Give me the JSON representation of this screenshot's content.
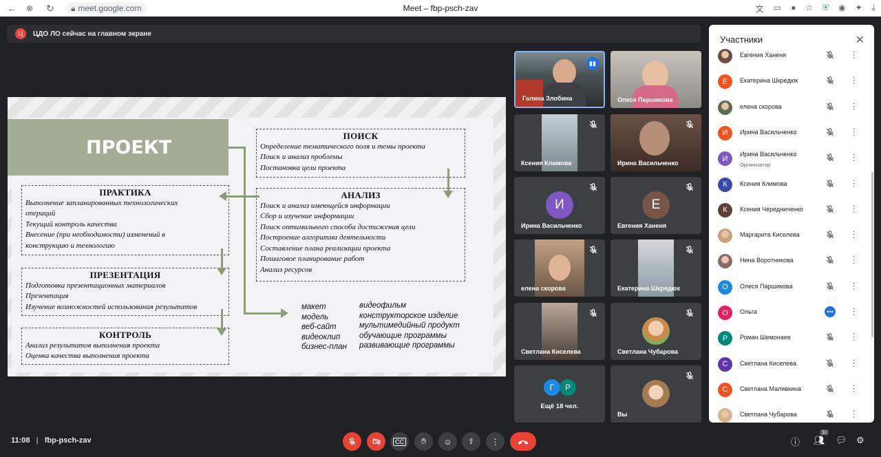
{
  "browser": {
    "url": "meet.google.com",
    "title": "Meet – fbp-psch-zav"
  },
  "banner": {
    "avatar": "Ц",
    "text": "ЦДО ЛО сейчас на главном экране"
  },
  "slide": {
    "title": "ПРОЕКТ",
    "poisk": {
      "heading": "ПОИСК",
      "lines": [
        "Определение тематического поля и темы проекта",
        "Поиск и анализ проблемы",
        "Постановка цели проекта"
      ]
    },
    "analiz": {
      "heading": "АНАЛИЗ",
      "lines": [
        "Поиск и анализ имеющейся информации",
        "Сбор и изучение информации",
        "Поиск оптимального способа достижения цели",
        "Построение алгоритма деятельности",
        "Составление плана реализации проекта",
        "Пошаговое планирование работ",
        "Анализ ресурсов"
      ]
    },
    "praktika": {
      "heading": "ПРАКТИКА",
      "lines": [
        "Выполнение запланированных технологических",
        "операций",
        "Текущий контроль качества",
        "Внесение (при необходимости) изменений в",
        "конструкцию и технологию"
      ]
    },
    "prezentaciya": {
      "heading": "ПРЕЗЕНТАЦИЯ",
      "lines": [
        "Подготовка презентационных материалов",
        "Презентация",
        "Изучение возможностей использования результатов"
      ]
    },
    "kontrol": {
      "heading": "КОНТРОЛЬ",
      "lines": [
        "Анализ результатов выполнения проекта",
        "Оценка качества выполнения проекта"
      ]
    },
    "products_col1": [
      "макет",
      "модель",
      "веб-сайт",
      "видеоклип",
      "бизнес-план"
    ],
    "products_col2": [
      "видеофильм",
      "конструкторское изделие",
      "мультимедийный продукт",
      "обучающие программы",
      "развивающие программы"
    ]
  },
  "tiles": [
    {
      "name": "Галина Злобина",
      "type": "video",
      "speaking": true
    },
    {
      "name": "Олеся Паршикова",
      "type": "video"
    },
    {
      "name": "Ксения Климова",
      "type": "video",
      "muted": true
    },
    {
      "name": "Ирина Васильченко",
      "type": "video",
      "muted": true
    },
    {
      "name": "Ирина Васильченко",
      "type": "avatar",
      "letter": "И",
      "color": "#7e57c2",
      "muted": true
    },
    {
      "name": "Евгения Ханеня",
      "type": "avatar",
      "letter": "Е",
      "color": "#795548",
      "muted": true
    },
    {
      "name": "елена скорова",
      "type": "video",
      "muted": true
    },
    {
      "name": "Екатерина Шкредюк",
      "type": "video",
      "muted": true
    },
    {
      "name": "Светлана Киселева",
      "type": "video",
      "muted": true
    },
    {
      "name": "Светлана Чубарова",
      "type": "photo",
      "muted": true
    },
    {
      "name": "Ещё 18 чел.",
      "type": "more",
      "letters": [
        "Г",
        "Р"
      ]
    },
    {
      "name": "Вы",
      "type": "photo",
      "muted": true
    }
  ],
  "panel": {
    "title": "Участники",
    "participants": [
      {
        "name": "Евгения Ханеня",
        "letter": "",
        "color": "#6d4c41",
        "photo": true
      },
      {
        "name": "Екатерина Шкредюк",
        "letter": "Е",
        "color": "#f4511e"
      },
      {
        "name": "елена скорова",
        "letter": "",
        "color": "#5d6d4e",
        "photo": true
      },
      {
        "name": "Ирина Васильченко",
        "letter": "И",
        "color": "#f4511e"
      },
      {
        "name": "Ирина Васильченко",
        "letter": "И",
        "color": "#7e57c2",
        "sub": "Организатор"
      },
      {
        "name": "Ксения Климова",
        "letter": "К",
        "color": "#3949ab"
      },
      {
        "name": "Ксения Чередниченко",
        "letter": "К",
        "color": "#5d4037"
      },
      {
        "name": "Маргарита Киселева",
        "letter": "",
        "color": "#c8a27a",
        "photo": true
      },
      {
        "name": "Нина Воротникова",
        "letter": "",
        "color": "#8a6a6a",
        "photo": true
      },
      {
        "name": "Олеся Паршикова",
        "letter": "О",
        "color": "#1e88e5"
      },
      {
        "name": "Ольга",
        "letter": "О",
        "color": "#e91e63",
        "speaking": true
      },
      {
        "name": "Роман Шемонаев",
        "letter": "Р",
        "color": "#00897b"
      },
      {
        "name": "Светлана Киселева",
        "letter": "С",
        "color": "#5e35b1"
      },
      {
        "name": "Светлана Малявкина",
        "letter": "С",
        "color": "#f4511e"
      },
      {
        "name": "Светлана Чубарова",
        "letter": "",
        "color": "#d9b38c",
        "photo": true
      }
    ]
  },
  "bottom": {
    "time": "11:08",
    "meeting": "fbp-psch-zav",
    "participants_count": "30"
  }
}
